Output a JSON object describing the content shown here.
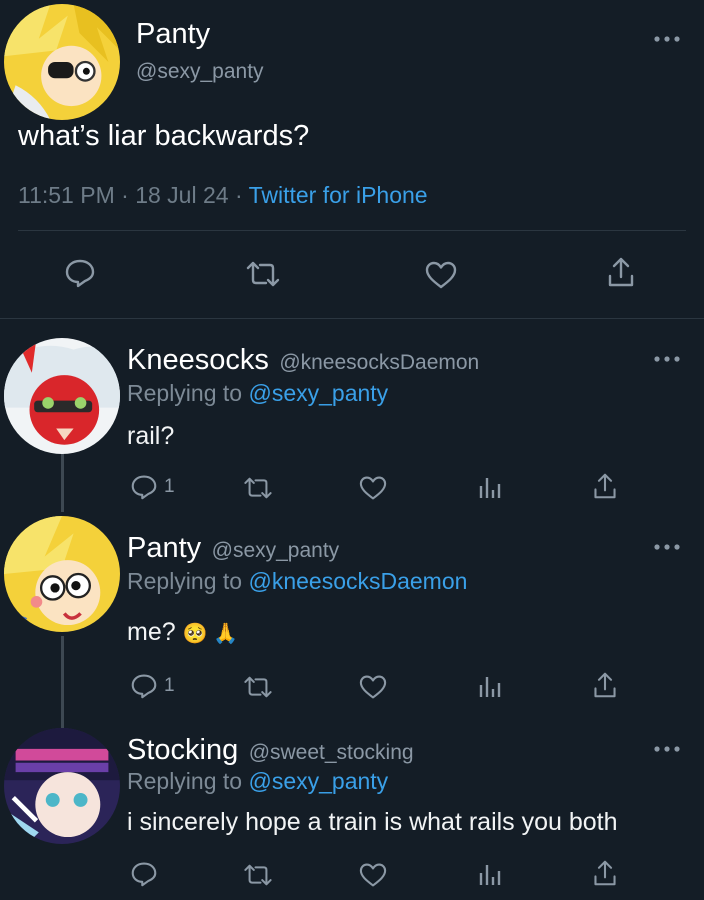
{
  "main_tweet": {
    "name": "Panty",
    "handle": "@sexy_panty",
    "text": "what’s liar backwards?",
    "time": "11:51 PM",
    "separator1": "·",
    "date": "18 Jul 24",
    "separator2": "·",
    "source": "Twitter for iPhone"
  },
  "replies": [
    {
      "name": "Kneesocks",
      "handle": "@kneesocksDaemon",
      "replying_prefix": "Replying to",
      "replying_to": "@sexy_panty",
      "text": "rail?",
      "reply_count": "1"
    },
    {
      "name": "Panty",
      "handle": "@sexy_panty",
      "replying_prefix": "Replying to",
      "replying_to": "@kneesocksDaemon",
      "text": "me?",
      "emoji": "🥺 🙏",
      "reply_count": "1"
    },
    {
      "name": "Stocking",
      "handle": "@sweet_stocking",
      "replying_prefix": "Replying to",
      "replying_to": "@sexy_panty",
      "text": "i sincerely hope a train is what rails you both",
      "reply_count": ""
    }
  ],
  "icons": {
    "reply": "speech-bubble-icon",
    "retweet": "retweet-icon",
    "like": "heart-icon",
    "analytics": "bar-chart-icon",
    "share": "share-icon",
    "more": "more-dots-icon"
  },
  "colors": {
    "background": "#141d26",
    "link": "#3aa0e8",
    "muted": "#8b98a5"
  }
}
